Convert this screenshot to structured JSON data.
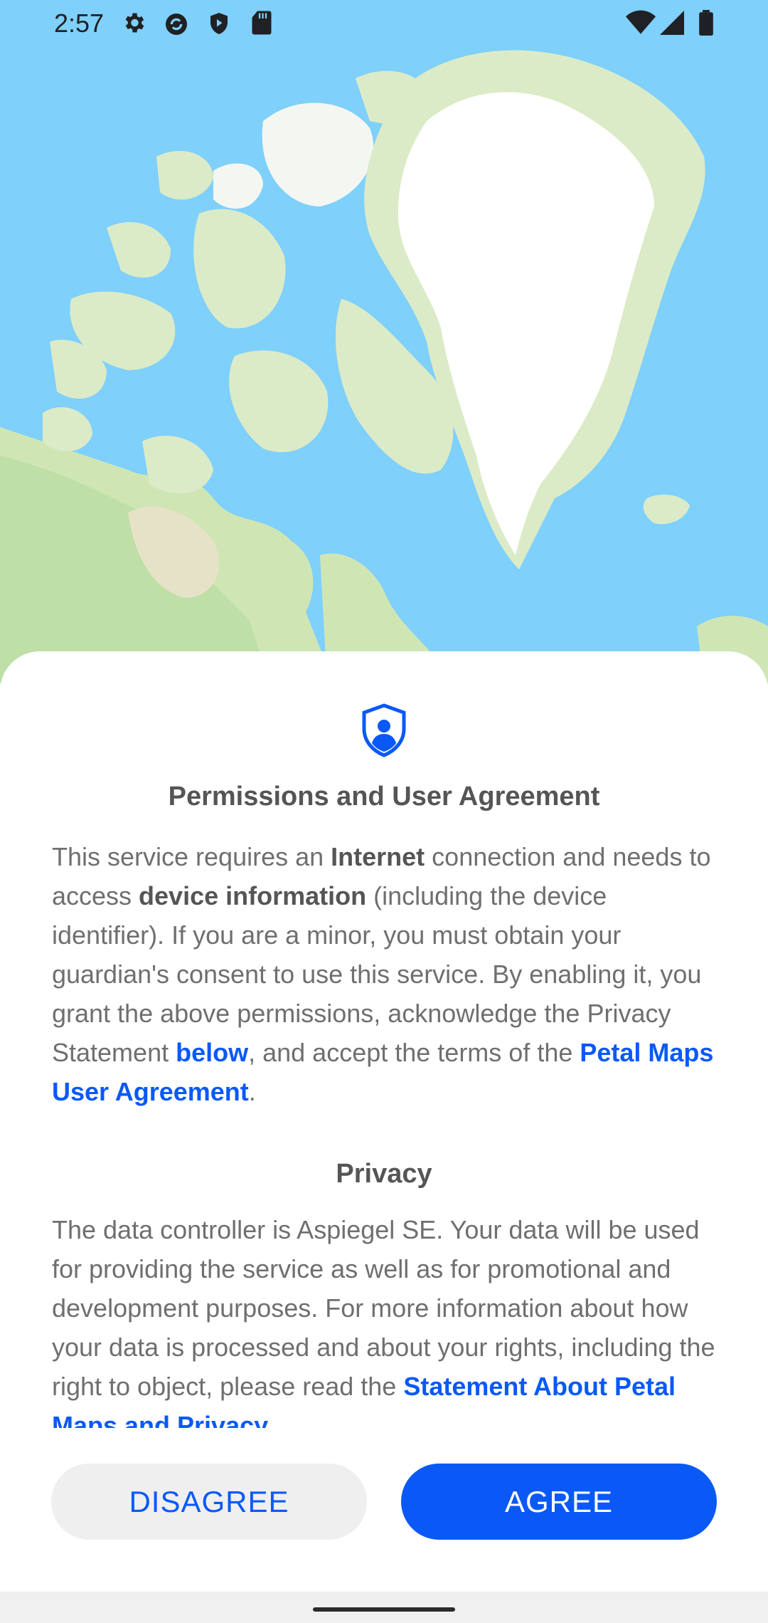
{
  "status_bar": {
    "time": "2:57",
    "left_icons": [
      "settings-icon",
      "sync-icon",
      "shield-play-icon",
      "sd-card-icon"
    ],
    "right_icons": [
      "wifi-icon",
      "signal-icon",
      "battery-icon"
    ]
  },
  "dialog": {
    "icon": "privacy-shield-icon",
    "title": "Permissions and User Agreement",
    "body": {
      "t1": "This service requires an ",
      "b1": "Internet",
      "t2": " connection and needs to access ",
      "b2": "device information",
      "t3": " (including the device identifier). If you are a minor, you must obtain your guardian's consent to use this service. By enabling it, you grant the above permissions, acknowledge the Privacy Statement ",
      "link_below": "below",
      "t4": ", and accept the terms of the ",
      "link_agreement": "Petal Maps User Agreement",
      "t5": "."
    },
    "privacy": {
      "title": "Privacy",
      "t1": "The data controller is Aspiegel SE. Your data will be used for providing the service as well as for promotional and development purposes. For more information about how your data is processed and about your rights, including the right to object, please read the ",
      "link_statement": "Statement About Petal Maps and Privacy"
    },
    "buttons": {
      "disagree": "DISAGREE",
      "agree": "AGREE"
    }
  },
  "colors": {
    "accent": "#0a59f7",
    "ocean": "#7fd0fb",
    "land": "#dcebc7",
    "ice": "#ffffff"
  }
}
